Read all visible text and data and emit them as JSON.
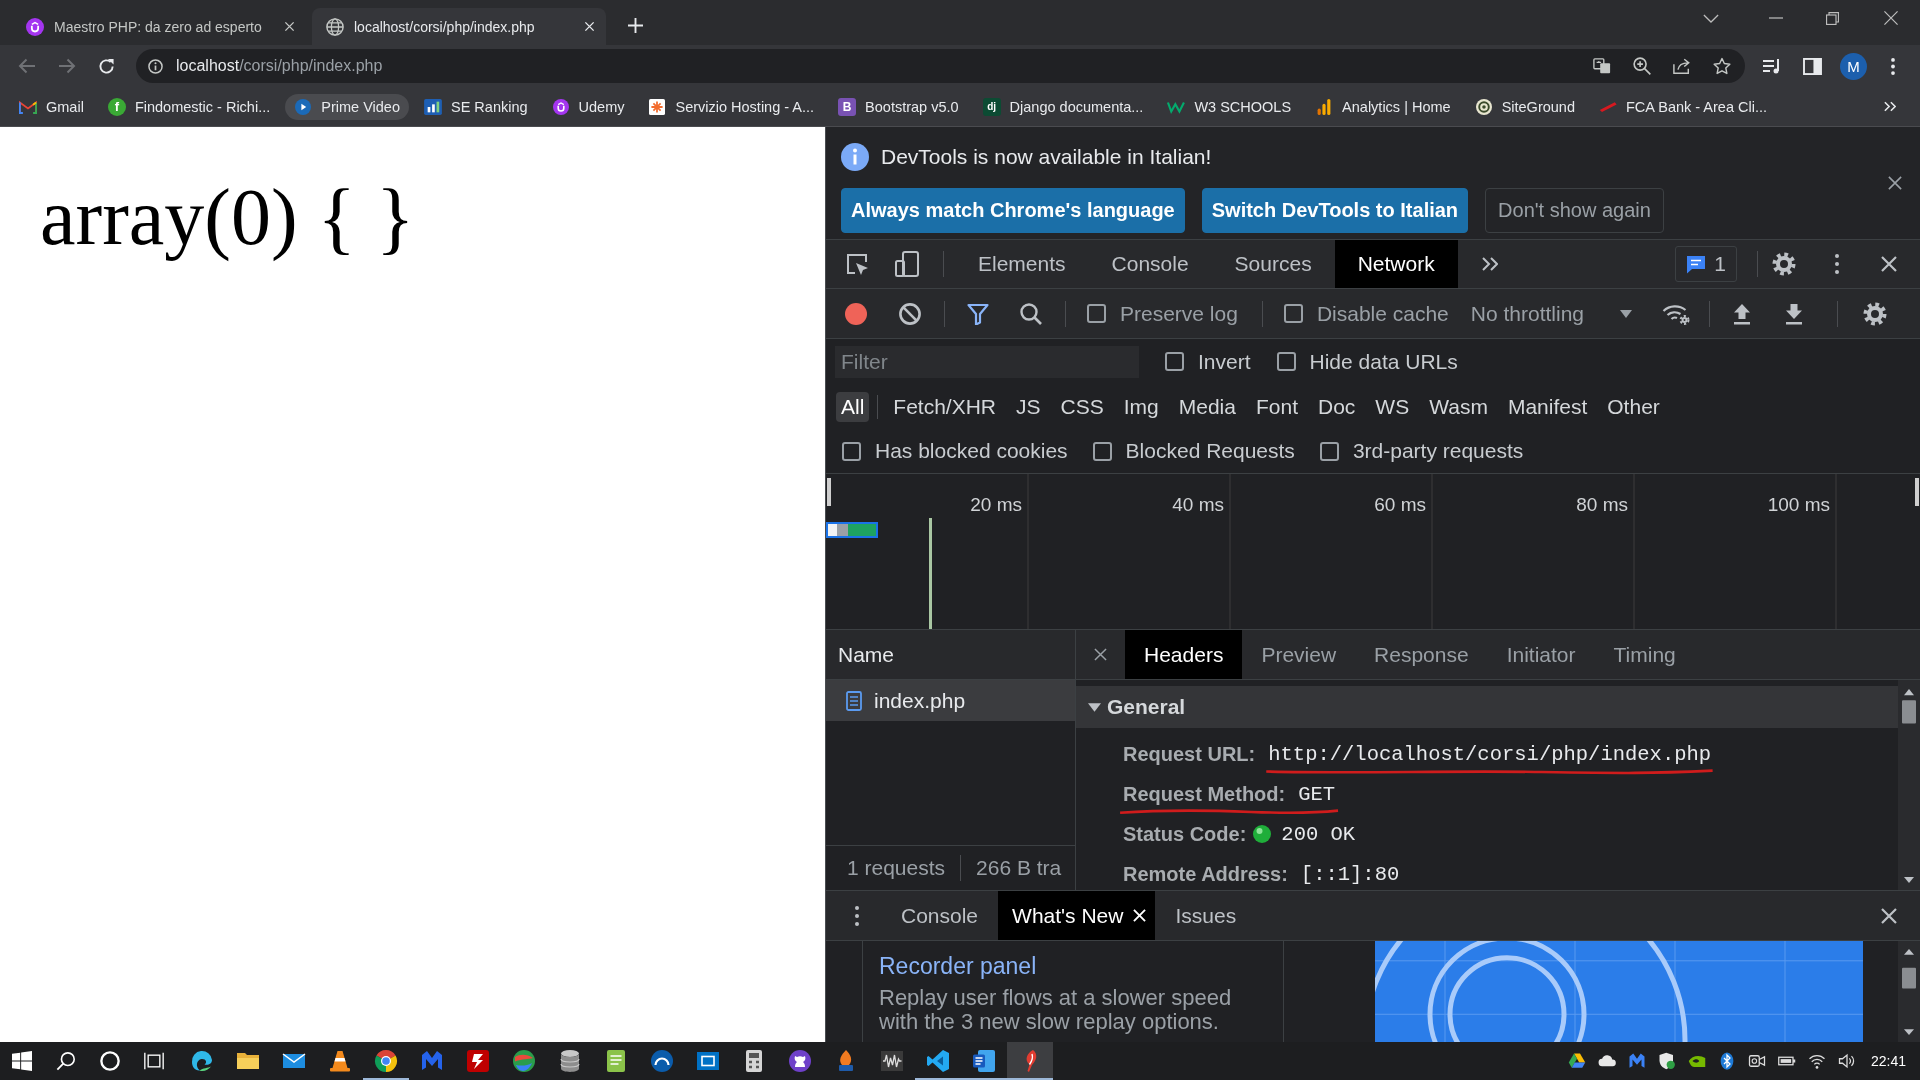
{
  "browser": {
    "tabs": [
      {
        "title": "Maestro PHP: da zero ad esperto",
        "selected": false
      },
      {
        "title": "localhost/corsi/php/index.php",
        "selected": true
      }
    ],
    "address_bar": {
      "host": "localhost",
      "path": "/corsi/php/index.php"
    },
    "profile_initial": "M",
    "bookmarks": [
      {
        "label": "Gmail",
        "hovered": false
      },
      {
        "label": "Findomestic - Richi...",
        "hovered": false,
        "favicon_text": "f"
      },
      {
        "label": "Prime Video",
        "hovered": true
      },
      {
        "label": "SE Ranking",
        "hovered": false
      },
      {
        "label": "Udemy",
        "hovered": false
      },
      {
        "label": "Servizio Hosting - A...",
        "hovered": false
      },
      {
        "label": "Bootstrap v5.0",
        "hovered": false,
        "favicon_text": "B"
      },
      {
        "label": "Django documenta...",
        "hovered": false,
        "favicon_text": "dj"
      },
      {
        "label": "W3 SCHOOLS",
        "hovered": false
      },
      {
        "label": "Analytics | Home",
        "hovered": false
      },
      {
        "label": "SiteGround",
        "hovered": false
      },
      {
        "label": "FCA Bank - Area Cli...",
        "hovered": false
      }
    ]
  },
  "page": {
    "output": "array(0) { }"
  },
  "devtools": {
    "infobar": {
      "message": "DevTools is now available in Italian!",
      "buttons": [
        {
          "label": "Always match Chrome's language",
          "kind": "primary"
        },
        {
          "label": "Switch DevTools to Italian",
          "kind": "primary"
        },
        {
          "label": "Don't show again",
          "kind": "secondary"
        }
      ]
    },
    "tabs": [
      {
        "label": "Elements",
        "selected": false
      },
      {
        "label": "Console",
        "selected": false
      },
      {
        "label": "Sources",
        "selected": false
      },
      {
        "label": "Network",
        "selected": true
      }
    ],
    "issues_count": "1",
    "toolbar": {
      "recording": true,
      "filter_active": true,
      "options": [
        {
          "label": "Preserve log",
          "checked": false
        },
        {
          "label": "Disable cache",
          "checked": false
        }
      ],
      "throttling": "No throttling"
    },
    "filter": {
      "placeholder": "Filter",
      "options": [
        {
          "label": "Invert",
          "checked": false
        },
        {
          "label": "Hide data URLs",
          "checked": false
        }
      ]
    },
    "types": [
      {
        "label": "All",
        "selected": true
      },
      {
        "label": "Fetch/XHR",
        "selected": false
      },
      {
        "label": "JS",
        "selected": false
      },
      {
        "label": "CSS",
        "selected": false
      },
      {
        "label": "Img",
        "selected": false
      },
      {
        "label": "Media",
        "selected": false
      },
      {
        "label": "Font",
        "selected": false
      },
      {
        "label": "Doc",
        "selected": false
      },
      {
        "label": "WS",
        "selected": false
      },
      {
        "label": "Wasm",
        "selected": false
      },
      {
        "label": "Manifest",
        "selected": false
      },
      {
        "label": "Other",
        "selected": false
      }
    ],
    "blocked_options": [
      {
        "label": "Has blocked cookies",
        "checked": false
      },
      {
        "label": "Blocked Requests",
        "checked": false
      },
      {
        "label": "3rd-party requests",
        "checked": false
      }
    ],
    "overview": {
      "ticks": [
        "20 ms",
        "40 ms",
        "60 ms",
        "80 ms",
        "100 ms"
      ]
    },
    "requests": {
      "column": "Name",
      "rows": [
        {
          "name": "index.php",
          "selected": true
        }
      ],
      "summary": [
        "1 requests",
        "266 B tra"
      ]
    },
    "details": {
      "tabs": [
        {
          "label": "Headers",
          "selected": true
        },
        {
          "label": "Preview",
          "selected": false
        },
        {
          "label": "Response",
          "selected": false
        },
        {
          "label": "Initiator",
          "selected": false
        },
        {
          "label": "Timing",
          "selected": false
        }
      ],
      "section": {
        "title": "General",
        "expanded": true,
        "rows": [
          {
            "label": "Request URL:",
            "value": "http://localhost/corsi/php/index.php",
            "kind": "plain",
            "label_underlined": false,
            "value_underlined": true
          },
          {
            "label": "Request Method:",
            "value": "GET",
            "kind": "plain",
            "label_underlined": true,
            "value_underlined": true
          },
          {
            "label": "Status Code:",
            "value": "200 OK",
            "kind": "status",
            "label_underlined": false,
            "value_underlined": false
          },
          {
            "label": "Remote Address:",
            "value": "[::1]:80",
            "kind": "plain",
            "label_underlined": false,
            "value_underlined": false
          }
        ]
      }
    },
    "drawer": {
      "tabs": [
        {
          "label": "Console",
          "selected": false,
          "closable": false
        },
        {
          "label": "What's New",
          "selected": true,
          "closable": true
        },
        {
          "label": "Issues",
          "selected": false,
          "closable": false
        }
      ],
      "article": {
        "title": "Recorder panel",
        "text": "Replay user flows at a slower speed with the 3 new slow replay options."
      }
    }
  },
  "taskbar": {
    "apps": [
      {
        "running": false,
        "active": false
      },
      {
        "running": false,
        "active": false
      },
      {
        "running": false,
        "active": false
      },
      {
        "running": false,
        "active": false
      },
      {
        "running": true,
        "active": false
      },
      {
        "running": false,
        "active": false
      },
      {
        "running": false,
        "active": false
      },
      {
        "running": false,
        "active": false
      },
      {
        "running": false,
        "active": false
      },
      {
        "running": false,
        "active": false
      },
      {
        "running": false,
        "active": false
      },
      {
        "running": false,
        "active": false
      },
      {
        "running": false,
        "active": false
      },
      {
        "running": false,
        "active": false
      },
      {
        "running": false,
        "active": false
      },
      {
        "running": false,
        "active": false
      },
      {
        "running": true,
        "active": false
      },
      {
        "running": true,
        "active": false
      },
      {
        "running": true,
        "active": true
      }
    ],
    "clock": "22:41"
  }
}
